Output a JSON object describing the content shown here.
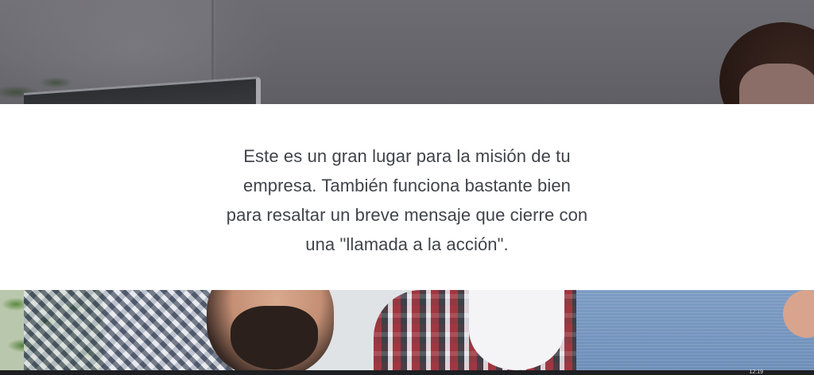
{
  "hero_top": {
    "image_description": "Office scene with computer monitor and a person with dark hair"
  },
  "mission": {
    "text": "Este es un gran lugar para la misión de tu empresa. También funciona bastante bien para resaltar un breve mensaje que cierre con una \"llamada a la acción\"."
  },
  "hero_bottom": {
    "image_description": "Team of coworkers in plaid and denim shirts collaborating"
  },
  "taskbar": {
    "clock": "12:19"
  },
  "colors": {
    "mission_text": "#40444a",
    "mission_bg": "#ffffff",
    "hero_overlay": "#66656b"
  }
}
